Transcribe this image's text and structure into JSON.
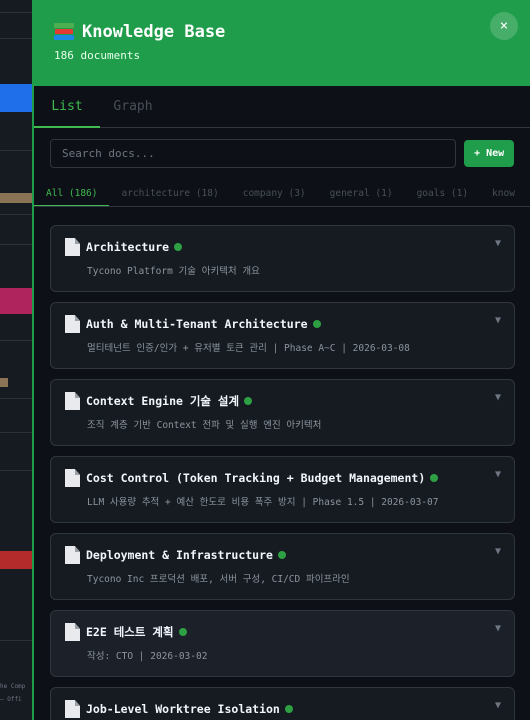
{
  "background_app": {
    "footer_lines": [
      "he Comp",
      "— Offi"
    ]
  },
  "panel": {
    "icon": "books-icon",
    "title": "Knowledge Base",
    "subtitle": "186 documents",
    "close_label": "×"
  },
  "view_tabs": [
    {
      "label": "List",
      "active": true
    },
    {
      "label": "Graph",
      "active": false
    }
  ],
  "search": {
    "placeholder": "Search docs...",
    "value": ""
  },
  "new_button": {
    "label": "+ New"
  },
  "filters": [
    {
      "label": "All (186)",
      "active": true
    },
    {
      "label": "architecture (18)",
      "active": false
    },
    {
      "label": "company (3)",
      "active": false
    },
    {
      "label": "general (1)",
      "active": false
    },
    {
      "label": "goals (1)",
      "active": false
    },
    {
      "label": "know",
      "active": false
    }
  ],
  "documents": [
    {
      "title": "Architecture",
      "desc": "Tycono Platform 기술 아키텍처 개요",
      "status": "active"
    },
    {
      "title": "Auth & Multi-Tenant Architecture",
      "desc": "멀티테넌트 인증/인가 + 유저별 토큰 관리 | Phase A~C | 2026-03-08",
      "status": "active"
    },
    {
      "title": "Context Engine 기술 설계",
      "desc": "조직 계층 기반 Context 전파 및 실행 엔진 아키텍처",
      "status": "active"
    },
    {
      "title": "Cost Control (Token Tracking + Budget Management)",
      "desc": "LLM 사용량 추적 + 예산 한도로 비용 폭주 방지 | Phase 1.5 | 2026-03-07",
      "status": "active"
    },
    {
      "title": "Deployment & Infrastructure",
      "desc": "Tycono Inc 프로덕션 배포, 서버 구성, CI/CD 파이프라인",
      "status": "active"
    },
    {
      "title": "E2E 테스트 계획",
      "desc": "작성: CTO | 2026-03-02",
      "status": "active"
    },
    {
      "title": "Job-Level Worktree Isolation",
      "desc": "",
      "status": "active"
    }
  ],
  "colors": {
    "accent": "#1f9d4a",
    "status_active": "#2ea043",
    "bg": "#0d1117",
    "card": "#161b22"
  }
}
